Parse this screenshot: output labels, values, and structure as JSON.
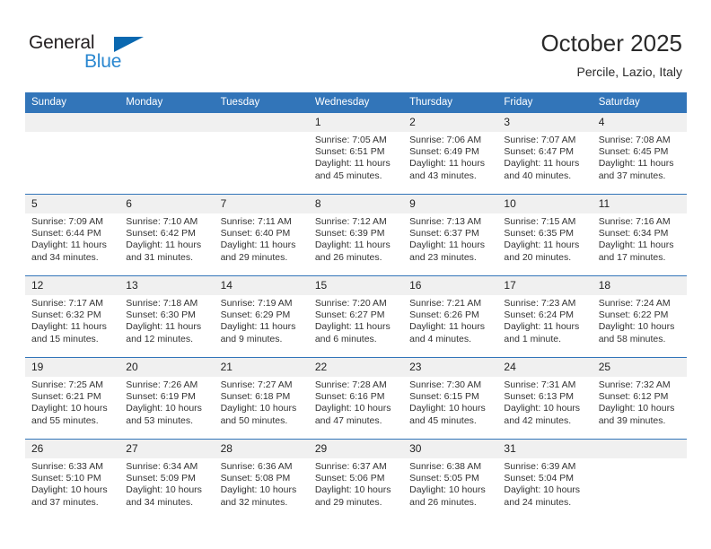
{
  "brand": {
    "name_top": "General",
    "name_bottom": "Blue",
    "triangle_color": "#0a68b0",
    "blue_color": "#2a87d0"
  },
  "header": {
    "month_title": "October 2025",
    "location": "Percile, Lazio, Italy"
  },
  "theme": {
    "header_blue": "#3275b9",
    "daynum_band": "#f0f0f0",
    "text": "#333333"
  },
  "weekday_headers": [
    "Sunday",
    "Monday",
    "Tuesday",
    "Wednesday",
    "Thursday",
    "Friday",
    "Saturday"
  ],
  "weeks": [
    [
      {
        "day": "",
        "sunrise": "",
        "sunset": "",
        "daylight": "",
        "empty": true
      },
      {
        "day": "",
        "sunrise": "",
        "sunset": "",
        "daylight": "",
        "empty": true
      },
      {
        "day": "",
        "sunrise": "",
        "sunset": "",
        "daylight": "",
        "empty": true
      },
      {
        "day": "1",
        "sunrise": "Sunrise: 7:05 AM",
        "sunset": "Sunset: 6:51 PM",
        "daylight": "Daylight: 11 hours and 45 minutes."
      },
      {
        "day": "2",
        "sunrise": "Sunrise: 7:06 AM",
        "sunset": "Sunset: 6:49 PM",
        "daylight": "Daylight: 11 hours and 43 minutes."
      },
      {
        "day": "3",
        "sunrise": "Sunrise: 7:07 AM",
        "sunset": "Sunset: 6:47 PM",
        "daylight": "Daylight: 11 hours and 40 minutes."
      },
      {
        "day": "4",
        "sunrise": "Sunrise: 7:08 AM",
        "sunset": "Sunset: 6:45 PM",
        "daylight": "Daylight: 11 hours and 37 minutes."
      }
    ],
    [
      {
        "day": "5",
        "sunrise": "Sunrise: 7:09 AM",
        "sunset": "Sunset: 6:44 PM",
        "daylight": "Daylight: 11 hours and 34 minutes."
      },
      {
        "day": "6",
        "sunrise": "Sunrise: 7:10 AM",
        "sunset": "Sunset: 6:42 PM",
        "daylight": "Daylight: 11 hours and 31 minutes."
      },
      {
        "day": "7",
        "sunrise": "Sunrise: 7:11 AM",
        "sunset": "Sunset: 6:40 PM",
        "daylight": "Daylight: 11 hours and 29 minutes."
      },
      {
        "day": "8",
        "sunrise": "Sunrise: 7:12 AM",
        "sunset": "Sunset: 6:39 PM",
        "daylight": "Daylight: 11 hours and 26 minutes."
      },
      {
        "day": "9",
        "sunrise": "Sunrise: 7:13 AM",
        "sunset": "Sunset: 6:37 PM",
        "daylight": "Daylight: 11 hours and 23 minutes."
      },
      {
        "day": "10",
        "sunrise": "Sunrise: 7:15 AM",
        "sunset": "Sunset: 6:35 PM",
        "daylight": "Daylight: 11 hours and 20 minutes."
      },
      {
        "day": "11",
        "sunrise": "Sunrise: 7:16 AM",
        "sunset": "Sunset: 6:34 PM",
        "daylight": "Daylight: 11 hours and 17 minutes."
      }
    ],
    [
      {
        "day": "12",
        "sunrise": "Sunrise: 7:17 AM",
        "sunset": "Sunset: 6:32 PM",
        "daylight": "Daylight: 11 hours and 15 minutes."
      },
      {
        "day": "13",
        "sunrise": "Sunrise: 7:18 AM",
        "sunset": "Sunset: 6:30 PM",
        "daylight": "Daylight: 11 hours and 12 minutes."
      },
      {
        "day": "14",
        "sunrise": "Sunrise: 7:19 AM",
        "sunset": "Sunset: 6:29 PM",
        "daylight": "Daylight: 11 hours and 9 minutes."
      },
      {
        "day": "15",
        "sunrise": "Sunrise: 7:20 AM",
        "sunset": "Sunset: 6:27 PM",
        "daylight": "Daylight: 11 hours and 6 minutes."
      },
      {
        "day": "16",
        "sunrise": "Sunrise: 7:21 AM",
        "sunset": "Sunset: 6:26 PM",
        "daylight": "Daylight: 11 hours and 4 minutes."
      },
      {
        "day": "17",
        "sunrise": "Sunrise: 7:23 AM",
        "sunset": "Sunset: 6:24 PM",
        "daylight": "Daylight: 11 hours and 1 minute."
      },
      {
        "day": "18",
        "sunrise": "Sunrise: 7:24 AM",
        "sunset": "Sunset: 6:22 PM",
        "daylight": "Daylight: 10 hours and 58 minutes."
      }
    ],
    [
      {
        "day": "19",
        "sunrise": "Sunrise: 7:25 AM",
        "sunset": "Sunset: 6:21 PM",
        "daylight": "Daylight: 10 hours and 55 minutes."
      },
      {
        "day": "20",
        "sunrise": "Sunrise: 7:26 AM",
        "sunset": "Sunset: 6:19 PM",
        "daylight": "Daylight: 10 hours and 53 minutes."
      },
      {
        "day": "21",
        "sunrise": "Sunrise: 7:27 AM",
        "sunset": "Sunset: 6:18 PM",
        "daylight": "Daylight: 10 hours and 50 minutes."
      },
      {
        "day": "22",
        "sunrise": "Sunrise: 7:28 AM",
        "sunset": "Sunset: 6:16 PM",
        "daylight": "Daylight: 10 hours and 47 minutes."
      },
      {
        "day": "23",
        "sunrise": "Sunrise: 7:30 AM",
        "sunset": "Sunset: 6:15 PM",
        "daylight": "Daylight: 10 hours and 45 minutes."
      },
      {
        "day": "24",
        "sunrise": "Sunrise: 7:31 AM",
        "sunset": "Sunset: 6:13 PM",
        "daylight": "Daylight: 10 hours and 42 minutes."
      },
      {
        "day": "25",
        "sunrise": "Sunrise: 7:32 AM",
        "sunset": "Sunset: 6:12 PM",
        "daylight": "Daylight: 10 hours and 39 minutes."
      }
    ],
    [
      {
        "day": "26",
        "sunrise": "Sunrise: 6:33 AM",
        "sunset": "Sunset: 5:10 PM",
        "daylight": "Daylight: 10 hours and 37 minutes."
      },
      {
        "day": "27",
        "sunrise": "Sunrise: 6:34 AM",
        "sunset": "Sunset: 5:09 PM",
        "daylight": "Daylight: 10 hours and 34 minutes."
      },
      {
        "day": "28",
        "sunrise": "Sunrise: 6:36 AM",
        "sunset": "Sunset: 5:08 PM",
        "daylight": "Daylight: 10 hours and 32 minutes."
      },
      {
        "day": "29",
        "sunrise": "Sunrise: 6:37 AM",
        "sunset": "Sunset: 5:06 PM",
        "daylight": "Daylight: 10 hours and 29 minutes."
      },
      {
        "day": "30",
        "sunrise": "Sunrise: 6:38 AM",
        "sunset": "Sunset: 5:05 PM",
        "daylight": "Daylight: 10 hours and 26 minutes."
      },
      {
        "day": "31",
        "sunrise": "Sunrise: 6:39 AM",
        "sunset": "Sunset: 5:04 PM",
        "daylight": "Daylight: 10 hours and 24 minutes."
      },
      {
        "day": "",
        "sunrise": "",
        "sunset": "",
        "daylight": "",
        "empty": true
      }
    ]
  ]
}
